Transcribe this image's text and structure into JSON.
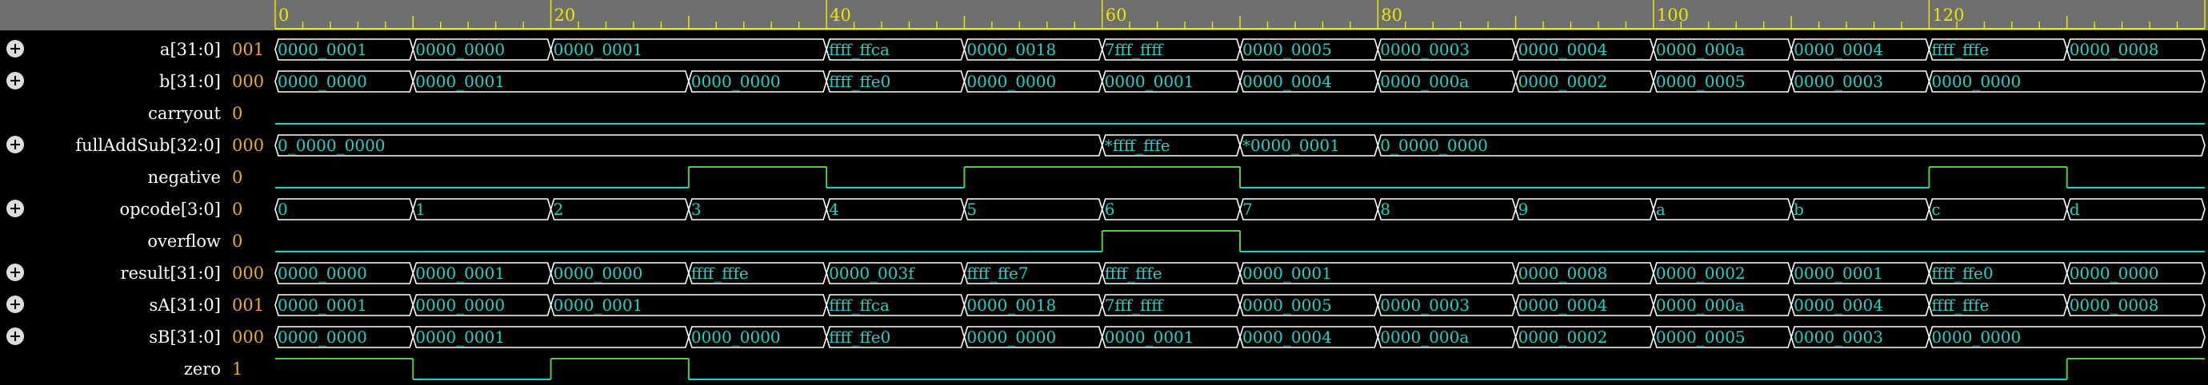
{
  "colors": {
    "header_bg": "#6f6f6f",
    "ruler": "#e8e800",
    "wave": "#19d4c8",
    "wave_one": "#50d040",
    "bus_text": "#19d4c8",
    "name_text": "#ffffff",
    "value_text": "#f0a830",
    "expand_icon": "#dcdcdc"
  },
  "timeline": {
    "start": 0,
    "end": 140,
    "labels": [
      "0",
      "20",
      "40",
      "60",
      "80",
      "100",
      "120"
    ]
  },
  "signals": [
    {
      "name": "a[31:0]",
      "value": "001",
      "expandable": true,
      "kind": "bus",
      "segments": [
        [
          0,
          "0000_0001"
        ],
        [
          10,
          "0000_0000"
        ],
        [
          20,
          "0000_0001"
        ],
        [
          40,
          "ffff_ffca"
        ],
        [
          50,
          "0000_0018"
        ],
        [
          60,
          "7fff_ffff"
        ],
        [
          70,
          "0000_0005"
        ],
        [
          80,
          "0000_0003"
        ],
        [
          90,
          "0000_0004"
        ],
        [
          100,
          "0000_000a"
        ],
        [
          110,
          "0000_0004"
        ],
        [
          120,
          "ffff_fffe"
        ],
        [
          130,
          "0000_0008"
        ]
      ]
    },
    {
      "name": "b[31:0]",
      "value": "000",
      "expandable": true,
      "kind": "bus",
      "segments": [
        [
          0,
          "0000_0000"
        ],
        [
          10,
          "0000_0001"
        ],
        [
          30,
          "0000_0000"
        ],
        [
          40,
          "ffff_ffe0"
        ],
        [
          50,
          "0000_0000"
        ],
        [
          60,
          "0000_0001"
        ],
        [
          70,
          "0000_0004"
        ],
        [
          80,
          "0000_000a"
        ],
        [
          90,
          "0000_0002"
        ],
        [
          100,
          "0000_0005"
        ],
        [
          110,
          "0000_0003"
        ],
        [
          120,
          "0000_0000"
        ]
      ]
    },
    {
      "name": "carryout",
      "value": "0",
      "expandable": false,
      "kind": "bit",
      "transitions": [
        [
          0,
          0
        ]
      ]
    },
    {
      "name": "fullAddSub[32:0]",
      "value": "000",
      "expandable": true,
      "kind": "bus",
      "segments": [
        [
          0,
          "0_0000_0000"
        ],
        [
          60,
          "*ffff_fffe"
        ],
        [
          70,
          "*0000_0001"
        ],
        [
          80,
          "0_0000_0000"
        ]
      ]
    },
    {
      "name": "negative",
      "value": "0",
      "expandable": false,
      "kind": "bit",
      "transitions": [
        [
          0,
          0
        ],
        [
          30,
          1
        ],
        [
          40,
          0
        ],
        [
          50,
          1
        ],
        [
          70,
          0
        ],
        [
          120,
          1
        ],
        [
          130,
          0
        ]
      ]
    },
    {
      "name": "opcode[3:0]",
      "value": "0",
      "expandable": true,
      "kind": "bus",
      "segments": [
        [
          0,
          "0"
        ],
        [
          10,
          "1"
        ],
        [
          20,
          "2"
        ],
        [
          30,
          "3"
        ],
        [
          40,
          "4"
        ],
        [
          50,
          "5"
        ],
        [
          60,
          "6"
        ],
        [
          70,
          "7"
        ],
        [
          80,
          "8"
        ],
        [
          90,
          "9"
        ],
        [
          100,
          "a"
        ],
        [
          110,
          "b"
        ],
        [
          120,
          "c"
        ],
        [
          130,
          "d"
        ]
      ]
    },
    {
      "name": "overflow",
      "value": "0",
      "expandable": false,
      "kind": "bit",
      "transitions": [
        [
          0,
          0
        ],
        [
          60,
          1
        ],
        [
          70,
          0
        ]
      ]
    },
    {
      "name": "result[31:0]",
      "value": "000",
      "expandable": true,
      "kind": "bus",
      "segments": [
        [
          0,
          "0000_0000"
        ],
        [
          10,
          "0000_0001"
        ],
        [
          20,
          "0000_0000"
        ],
        [
          30,
          "ffff_fffe"
        ],
        [
          40,
          "0000_003f"
        ],
        [
          50,
          "ffff_ffe7"
        ],
        [
          60,
          "ffff_fffe"
        ],
        [
          70,
          "0000_0001"
        ],
        [
          90,
          "0000_0008"
        ],
        [
          100,
          "0000_0002"
        ],
        [
          110,
          "0000_0001"
        ],
        [
          120,
          "ffff_ffe0"
        ],
        [
          130,
          "0000_0000"
        ]
      ]
    },
    {
      "name": "sA[31:0]",
      "value": "001",
      "expandable": true,
      "kind": "bus",
      "segments": [
        [
          0,
          "0000_0001"
        ],
        [
          10,
          "0000_0000"
        ],
        [
          20,
          "0000_0001"
        ],
        [
          40,
          "ffff_ffca"
        ],
        [
          50,
          "0000_0018"
        ],
        [
          60,
          "7fff_ffff"
        ],
        [
          70,
          "0000_0005"
        ],
        [
          80,
          "0000_0003"
        ],
        [
          90,
          "0000_0004"
        ],
        [
          100,
          "0000_000a"
        ],
        [
          110,
          "0000_0004"
        ],
        [
          120,
          "ffff_fffe"
        ],
        [
          130,
          "0000_0008"
        ]
      ]
    },
    {
      "name": "sB[31:0]",
      "value": "000",
      "expandable": true,
      "kind": "bus",
      "segments": [
        [
          0,
          "0000_0000"
        ],
        [
          10,
          "0000_0001"
        ],
        [
          30,
          "0000_0000"
        ],
        [
          40,
          "ffff_ffe0"
        ],
        [
          50,
          "0000_0000"
        ],
        [
          60,
          "0000_0001"
        ],
        [
          70,
          "0000_0004"
        ],
        [
          80,
          "0000_000a"
        ],
        [
          90,
          "0000_0002"
        ],
        [
          100,
          "0000_0005"
        ],
        [
          110,
          "0000_0003"
        ],
        [
          120,
          "0000_0000"
        ]
      ]
    },
    {
      "name": "zero",
      "value": "1",
      "expandable": false,
      "kind": "bit",
      "transitions": [
        [
          0,
          1
        ],
        [
          10,
          0
        ],
        [
          20,
          1
        ],
        [
          30,
          0
        ],
        [
          130,
          1
        ]
      ]
    }
  ]
}
